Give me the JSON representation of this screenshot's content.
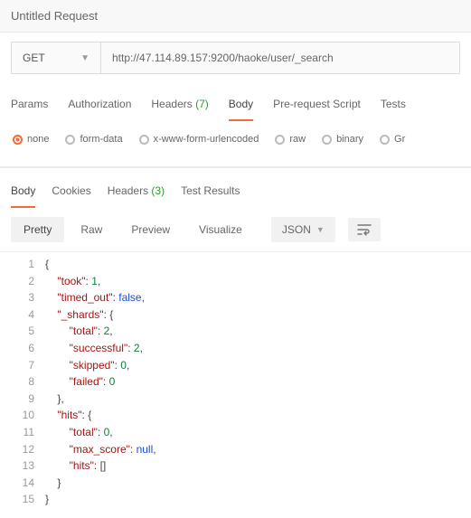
{
  "title": "Untitled Request",
  "method": "GET",
  "url": "http://47.114.89.157:9200/haoke/user/_search",
  "reqTabs": {
    "params": "Params",
    "auth": "Authorization",
    "headers": "Headers",
    "headersCount": "(7)",
    "body": "Body",
    "prerequest": "Pre-request Script",
    "tests": "Tests"
  },
  "bodyTypes": {
    "none": "none",
    "formdata": "form-data",
    "xwww": "x-www-form-urlencoded",
    "raw": "raw",
    "binary": "binary",
    "graphql": "Gr"
  },
  "respTabs": {
    "body": "Body",
    "cookies": "Cookies",
    "headers": "Headers",
    "headersCount": "(3)",
    "testresults": "Test Results"
  },
  "viewBar": {
    "pretty": "Pretty",
    "raw": "Raw",
    "preview": "Preview",
    "visualize": "Visualize",
    "format": "JSON"
  },
  "chart_data": {
    "type": "table",
    "description": "Elasticsearch _search response JSON",
    "data": {
      "took": 1,
      "timed_out": false,
      "_shards": {
        "total": 2,
        "successful": 2,
        "skipped": 0,
        "failed": 0
      },
      "hits": {
        "total": 0,
        "max_score": null,
        "hits": []
      }
    }
  },
  "code": {
    "lines": [
      "1",
      "2",
      "3",
      "4",
      "5",
      "6",
      "7",
      "8",
      "9",
      "10",
      "11",
      "12",
      "13",
      "14",
      "15"
    ]
  }
}
